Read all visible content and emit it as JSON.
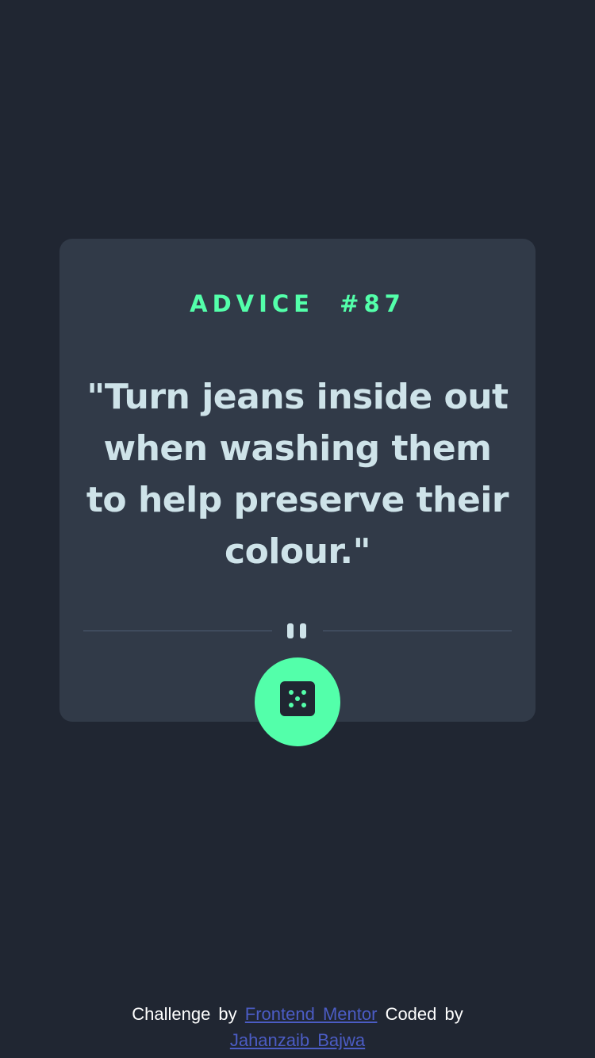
{
  "card": {
    "advice_label": "ADVICE  #87",
    "quote": "\"Turn jeans inside out when washing them to help preserve their colour.\"",
    "divider_icon": "pause-icon",
    "button_icon": "dice-icon"
  },
  "footer": {
    "challenge_text": "Challenge by",
    "challenge_link": "Frontend Mentor",
    "coded_text": "Coded by",
    "author_link": "Jahanzaib Bajwa"
  },
  "colors": {
    "background": "#202632",
    "card": "#313a48",
    "accent": "#53ffaa",
    "text": "#cee3e9",
    "divider": "#4f5d74",
    "link": "#4b5cc4"
  }
}
